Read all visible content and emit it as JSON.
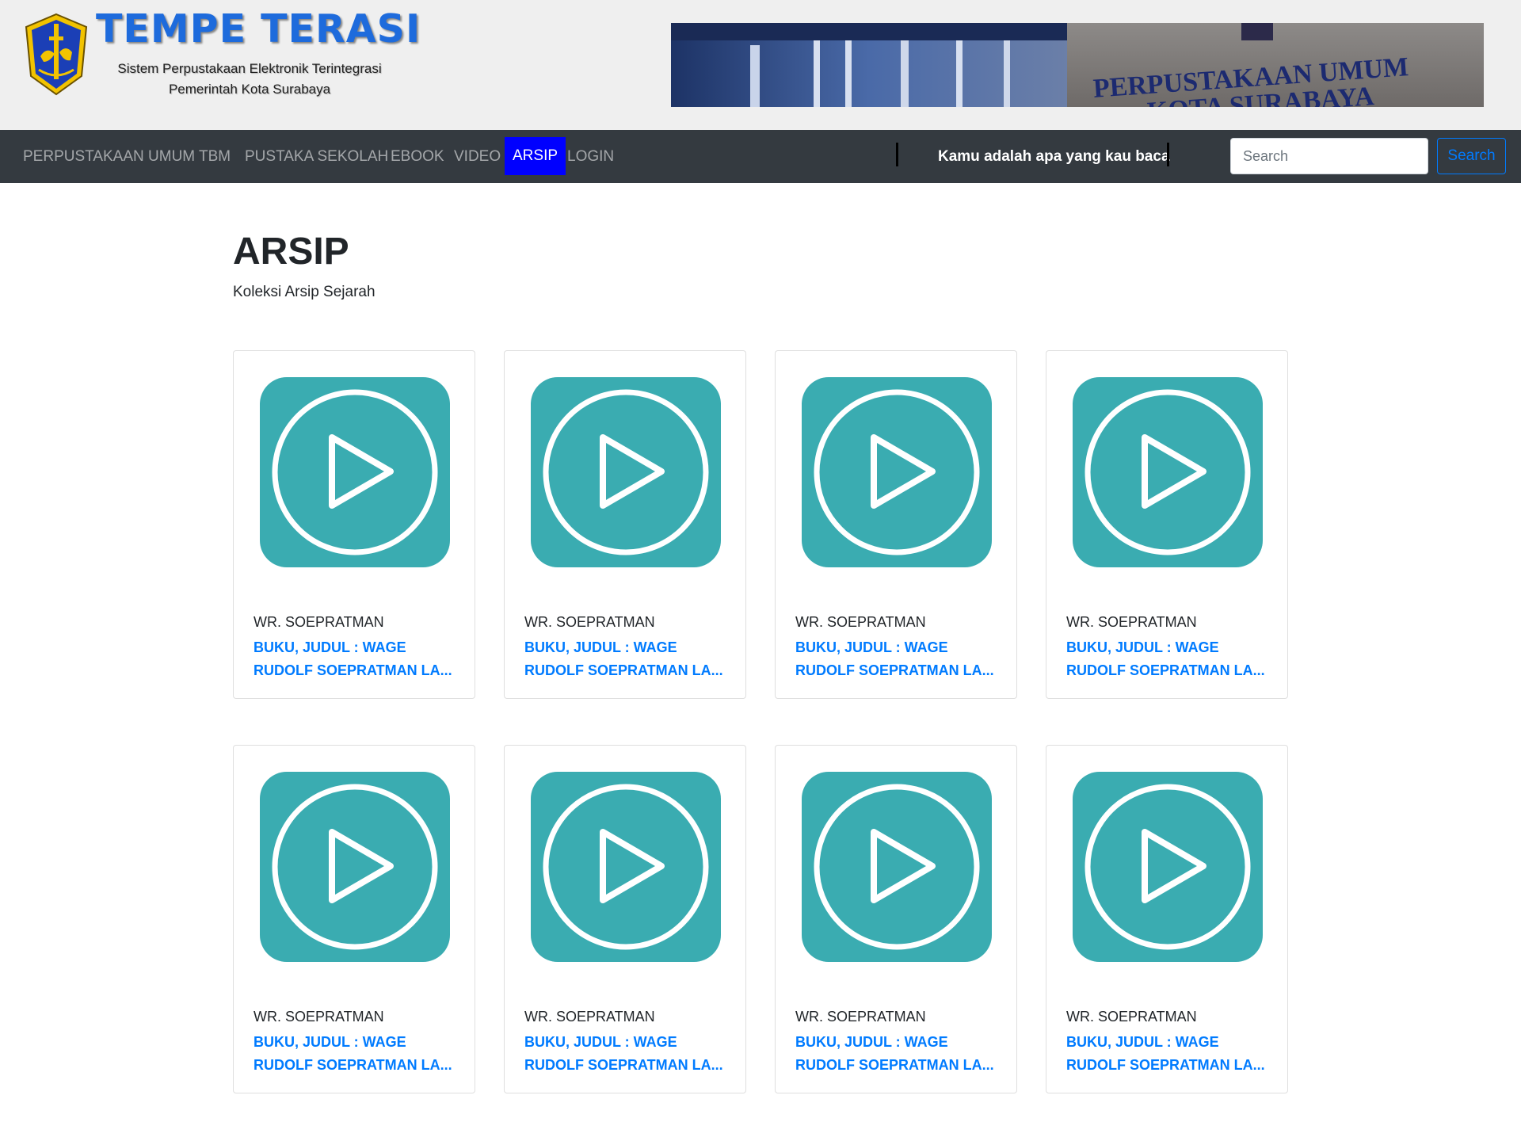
{
  "header": {
    "brand_title": "TEMPE TERASI",
    "brand_subtitle_line1": "Sistem Perpustakaan Elektronik Terintegrasi",
    "brand_subtitle_line2": "Pemerintah Kota Surabaya",
    "banner_text_line1": "PERPUSTAKAAN UMUM",
    "banner_text_line2": "KOTA SURABAYA"
  },
  "nav": {
    "items": [
      {
        "label": "PERPUSTAKAAN UMUM",
        "active": false
      },
      {
        "label": "TBM",
        "active": false
      },
      {
        "label": "PUSTAKA SEKOLAH",
        "active": false
      },
      {
        "label": "EBOOK",
        "active": false
      },
      {
        "label": "VIDEO",
        "active": false
      },
      {
        "label": "ARSIP",
        "active": true
      },
      {
        "label": "LOGIN",
        "active": false
      }
    ],
    "tagline": "Kamu adalah apa yang kau baca",
    "search_placeholder": "Search",
    "search_button": "Search"
  },
  "page": {
    "title": "ARSIP",
    "subtitle": "Koleksi Arsip Sejarah"
  },
  "cards": [
    {
      "author": "WR. SOEPRATMAN",
      "title_line1": "BUKU, JUDUL : WAGE",
      "title_line2": "RUDOLF SOEPRATMAN LA..."
    },
    {
      "author": "WR. SOEPRATMAN",
      "title_line1": "BUKU, JUDUL : WAGE",
      "title_line2": "RUDOLF SOEPRATMAN LA..."
    },
    {
      "author": "WR. SOEPRATMAN",
      "title_line1": "BUKU, JUDUL : WAGE",
      "title_line2": "RUDOLF SOEPRATMAN LA..."
    },
    {
      "author": "WR. SOEPRATMAN",
      "title_line1": "BUKU, JUDUL : WAGE",
      "title_line2": "RUDOLF SOEPRATMAN LA..."
    },
    {
      "author": "WR. SOEPRATMAN",
      "title_line1": "BUKU, JUDUL : WAGE",
      "title_line2": "RUDOLF SOEPRATMAN LA..."
    },
    {
      "author": "WR. SOEPRATMAN",
      "title_line1": "BUKU, JUDUL : WAGE",
      "title_line2": "RUDOLF SOEPRATMAN LA..."
    },
    {
      "author": "WR. SOEPRATMAN",
      "title_line1": "BUKU, JUDUL : WAGE",
      "title_line2": "RUDOLF SOEPRATMAN LA..."
    },
    {
      "author": "WR. SOEPRATMAN",
      "title_line1": "BUKU, JUDUL : WAGE",
      "title_line2": "RUDOLF SOEPRATMAN LA..."
    }
  ],
  "colors": {
    "header_bg": "#efefef",
    "navbar_bg": "#343a40",
    "active_nav_bg": "#0000ff",
    "brand_title": "#1e6bdc",
    "link": "#007bff",
    "thumb_bg": "#3aacb1"
  },
  "icons": {
    "logo": "surabaya-crest-icon",
    "card_thumb": "play-circle-icon"
  }
}
